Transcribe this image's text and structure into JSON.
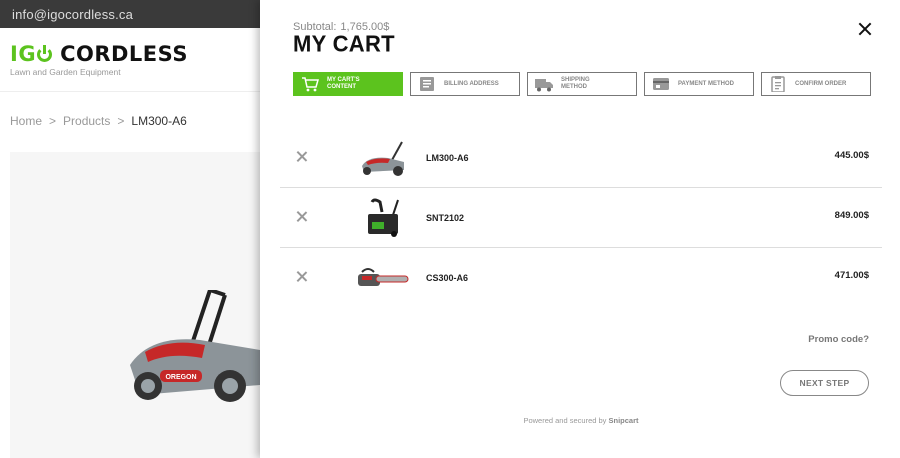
{
  "site": {
    "email": "info@igocordless.ca",
    "brand_prefix": "IG",
    "brand_name": "CORDLESS",
    "tagline": "Lawn and Garden Equipment",
    "breadcrumb": [
      "Home",
      ">",
      "Products",
      ">",
      "LM300-A6"
    ]
  },
  "cart": {
    "subtotal_label": "Subtotal:",
    "subtotal_value": "1,765.00$",
    "title": "MY CART",
    "steps": [
      {
        "label": "MY CART'S CONTENT",
        "icon": "cart-icon",
        "active": true
      },
      {
        "label": "BILLING ADDRESS",
        "icon": "billing-icon",
        "active": false
      },
      {
        "label": "SHIPPING METHOD",
        "icon": "truck-icon",
        "active": false
      },
      {
        "label": "PAYMENT METHOD",
        "icon": "credit-card-icon",
        "active": false
      },
      {
        "label": "CONFIRM ORDER",
        "icon": "clipboard-icon",
        "active": false
      }
    ],
    "items": [
      {
        "name": "LM300-A6",
        "price": "445.00$",
        "image": "lawn-mower"
      },
      {
        "name": "SNT2102",
        "price": "849.00$",
        "image": "snow-blower"
      },
      {
        "name": "CS300-A6",
        "price": "471.00$",
        "image": "chainsaw"
      }
    ],
    "promo_label": "Promo code?",
    "next_label": "NEXT STEP",
    "powered_text": "Powered and secured by",
    "powered_brand": "Snipcart"
  },
  "colors": {
    "accent": "#5cc31e",
    "topbar": "#3a3a3a"
  }
}
